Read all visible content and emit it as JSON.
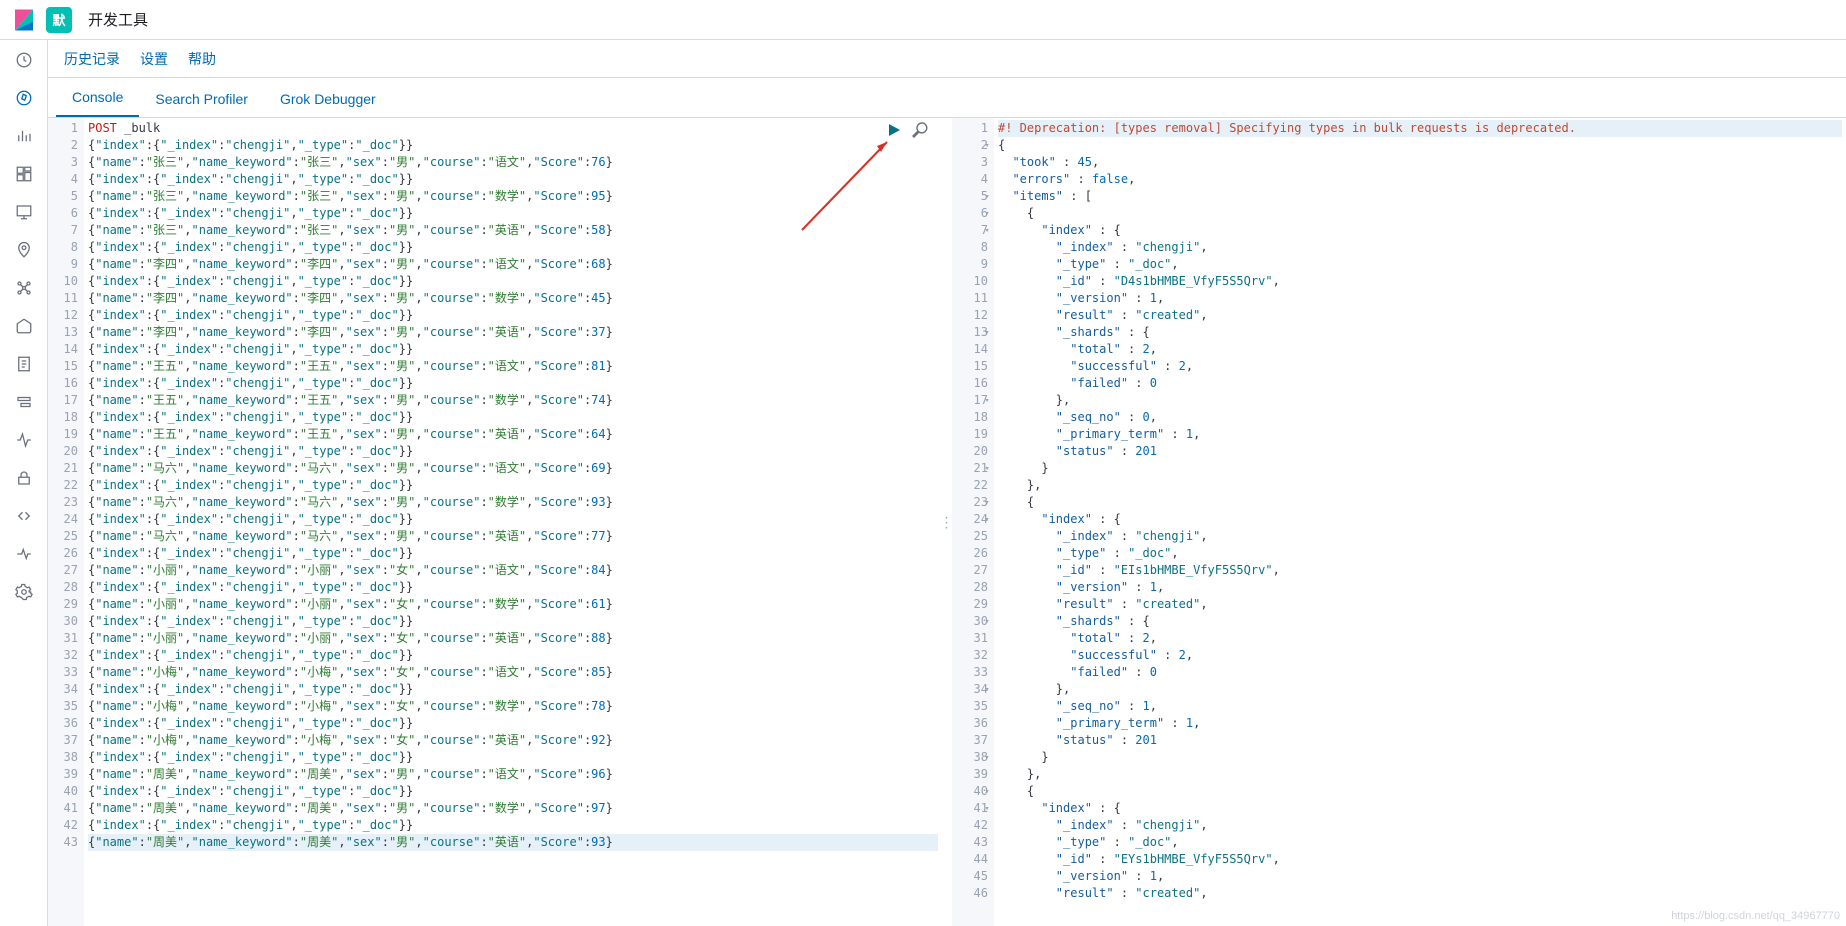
{
  "header": {
    "appTitle": "开发工具",
    "avatarLetter": "默"
  },
  "secondNav": {
    "history": "历史记录",
    "settings": "设置",
    "help": "帮助"
  },
  "tabs": {
    "console": "Console",
    "search": "Search Profiler",
    "grok": "Grok Debugger"
  },
  "request": {
    "method": "POST",
    "path": "_bulk",
    "lines": [
      "POST _bulk",
      "{\"index\":{\"_index\":\"chengji\",\"_type\":\"_doc\"}}",
      "{\"name\":\"张三\",\"name_keyword\":\"张三\",\"sex\":\"男\",\"course\":\"语文\",\"Score\":76}",
      "{\"index\":{\"_index\":\"chengji\",\"_type\":\"_doc\"}}",
      "{\"name\":\"张三\",\"name_keyword\":\"张三\",\"sex\":\"男\",\"course\":\"数学\",\"Score\":95}",
      "{\"index\":{\"_index\":\"chengji\",\"_type\":\"_doc\"}}",
      "{\"name\":\"张三\",\"name_keyword\":\"张三\",\"sex\":\"男\",\"course\":\"英语\",\"Score\":58}",
      "{\"index\":{\"_index\":\"chengji\",\"_type\":\"_doc\"}}",
      "{\"name\":\"李四\",\"name_keyword\":\"李四\",\"sex\":\"男\",\"course\":\"语文\",\"Score\":68}",
      "{\"index\":{\"_index\":\"chengji\",\"_type\":\"_doc\"}}",
      "{\"name\":\"李四\",\"name_keyword\":\"李四\",\"sex\":\"男\",\"course\":\"数学\",\"Score\":45}",
      "{\"index\":{\"_index\":\"chengji\",\"_type\":\"_doc\"}}",
      "{\"name\":\"李四\",\"name_keyword\":\"李四\",\"sex\":\"男\",\"course\":\"英语\",\"Score\":37}",
      "{\"index\":{\"_index\":\"chengji\",\"_type\":\"_doc\"}}",
      "{\"name\":\"王五\",\"name_keyword\":\"王五\",\"sex\":\"男\",\"course\":\"语文\",\"Score\":81}",
      "{\"index\":{\"_index\":\"chengji\",\"_type\":\"_doc\"}}",
      "{\"name\":\"王五\",\"name_keyword\":\"王五\",\"sex\":\"男\",\"course\":\"数学\",\"Score\":74}",
      "{\"index\":{\"_index\":\"chengji\",\"_type\":\"_doc\"}}",
      "{\"name\":\"王五\",\"name_keyword\":\"王五\",\"sex\":\"男\",\"course\":\"英语\",\"Score\":64}",
      "{\"index\":{\"_index\":\"chengji\",\"_type\":\"_doc\"}}",
      "{\"name\":\"马六\",\"name_keyword\":\"马六\",\"sex\":\"男\",\"course\":\"语文\",\"Score\":69}",
      "{\"index\":{\"_index\":\"chengji\",\"_type\":\"_doc\"}}",
      "{\"name\":\"马六\",\"name_keyword\":\"马六\",\"sex\":\"男\",\"course\":\"数学\",\"Score\":93}",
      "{\"index\":{\"_index\":\"chengji\",\"_type\":\"_doc\"}}",
      "{\"name\":\"马六\",\"name_keyword\":\"马六\",\"sex\":\"男\",\"course\":\"英语\",\"Score\":77}",
      "{\"index\":{\"_index\":\"chengji\",\"_type\":\"_doc\"}}",
      "{\"name\":\"小丽\",\"name_keyword\":\"小丽\",\"sex\":\"女\",\"course\":\"语文\",\"Score\":84}",
      "{\"index\":{\"_index\":\"chengji\",\"_type\":\"_doc\"}}",
      "{\"name\":\"小丽\",\"name_keyword\":\"小丽\",\"sex\":\"女\",\"course\":\"数学\",\"Score\":61}",
      "{\"index\":{\"_index\":\"chengji\",\"_type\":\"_doc\"}}",
      "{\"name\":\"小丽\",\"name_keyword\":\"小丽\",\"sex\":\"女\",\"course\":\"英语\",\"Score\":88}",
      "{\"index\":{\"_index\":\"chengji\",\"_type\":\"_doc\"}}",
      "{\"name\":\"小梅\",\"name_keyword\":\"小梅\",\"sex\":\"女\",\"course\":\"语文\",\"Score\":85}",
      "{\"index\":{\"_index\":\"chengji\",\"_type\":\"_doc\"}}",
      "{\"name\":\"小梅\",\"name_keyword\":\"小梅\",\"sex\":\"女\",\"course\":\"数学\",\"Score\":78}",
      "{\"index\":{\"_index\":\"chengji\",\"_type\":\"_doc\"}}",
      "{\"name\":\"小梅\",\"name_keyword\":\"小梅\",\"sex\":\"女\",\"course\":\"英语\",\"Score\":92}",
      "{\"index\":{\"_index\":\"chengji\",\"_type\":\"_doc\"}}",
      "{\"name\":\"周美\",\"name_keyword\":\"周美\",\"sex\":\"男\",\"course\":\"语文\",\"Score\":96}",
      "{\"index\":{\"_index\":\"chengji\",\"_type\":\"_doc\"}}",
      "{\"name\":\"周美\",\"name_keyword\":\"周美\",\"sex\":\"男\",\"course\":\"数学\",\"Score\":97}",
      "{\"index\":{\"_index\":\"chengji\",\"_type\":\"_doc\"}}",
      "{\"name\":\"周美\",\"name_keyword\":\"周美\",\"sex\":\"男\",\"course\":\"英语\",\"Score\":93}"
    ]
  },
  "response": {
    "lines": [
      "#! Deprecation: [types removal] Specifying types in bulk requests is deprecated.",
      "{",
      "  \"took\" : 45,",
      "  \"errors\" : false,",
      "  \"items\" : [",
      "    {",
      "      \"index\" : {",
      "        \"_index\" : \"chengji\",",
      "        \"_type\" : \"_doc\",",
      "        \"_id\" : \"D4s1bHMBE_VfyF5S5Qrv\",",
      "        \"_version\" : 1,",
      "        \"result\" : \"created\",",
      "        \"_shards\" : {",
      "          \"total\" : 2,",
      "          \"successful\" : 2,",
      "          \"failed\" : 0",
      "        },",
      "        \"_seq_no\" : 0,",
      "        \"_primary_term\" : 1,",
      "        \"status\" : 201",
      "      }",
      "    },",
      "    {",
      "      \"index\" : {",
      "        \"_index\" : \"chengji\",",
      "        \"_type\" : \"_doc\",",
      "        \"_id\" : \"EIs1bHMBE_VfyF5S5Qrv\",",
      "        \"_version\" : 1,",
      "        \"result\" : \"created\",",
      "        \"_shards\" : {",
      "          \"total\" : 2,",
      "          \"successful\" : 2,",
      "          \"failed\" : 0",
      "        },",
      "        \"_seq_no\" : 1,",
      "        \"_primary_term\" : 1,",
      "        \"status\" : 201",
      "      }",
      "    },",
      "    {",
      "      \"index\" : {",
      "        \"_index\" : \"chengji\",",
      "        \"_type\" : \"_doc\",",
      "        \"_id\" : \"EYs1bHMBE_VfyF5S5Qrv\",",
      "        \"_version\" : 1,",
      "        \"result\" : \"created\","
    ],
    "foldLines": [
      2,
      5,
      6,
      7,
      13,
      17,
      21,
      23,
      24,
      30,
      34,
      38,
      40,
      41
    ]
  },
  "watermark": "https://blog.csdn.net/qq_34967770",
  "sidebarIcons": [
    "recent-icon",
    "discover-icon",
    "visualize-icon",
    "dashboard-icon",
    "canvas-icon",
    "maps-icon",
    "ml-icon",
    "infra-icon",
    "logs-icon",
    "apm-icon",
    "uptime-icon",
    "security-icon",
    "devtools-icon",
    "monitoring-icon",
    "management-icon"
  ]
}
